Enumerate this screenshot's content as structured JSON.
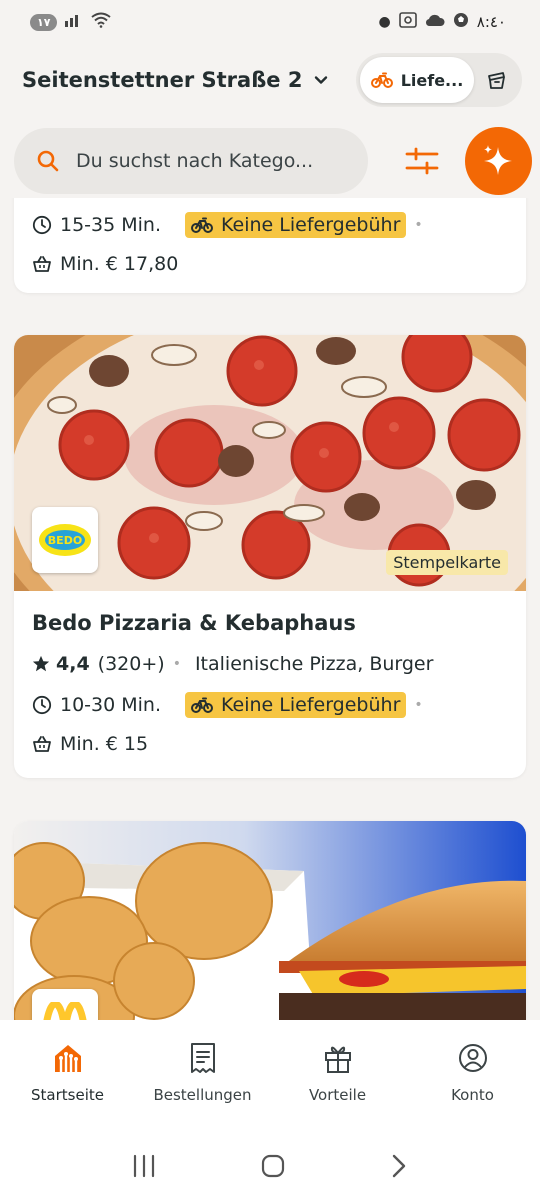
{
  "status_bar": {
    "left_badge": "١٧",
    "right_time": "٨:٤٠"
  },
  "header": {
    "address": "Seitenstettner Straße 2",
    "delivery_toggle_label": "Liefe...",
    "active_mode": "delivery"
  },
  "search": {
    "placeholder": "Du suchst nach Katego..."
  },
  "colors": {
    "accent": "#f36805",
    "badge_yellow": "#f6c543",
    "stempel_bg": "#f8e8a9"
  },
  "restaurants": [
    {
      "time": "15-35 Min.",
      "fee": "Keine Liefergebühr",
      "min_order": "Min. € 17,80"
    },
    {
      "name": "Bedo Pizzaria & Kebaphaus",
      "rating": "4,4",
      "rating_count": "(320+)",
      "cuisines": "Italienische Pizza, Burger",
      "time": "10-30 Min.",
      "fee": "Keine Liefergebühr",
      "min_order": "Min. € 15",
      "badge": "Stempelkarte",
      "logo_text": "BEDO"
    },
    {
      "logo_text": "M"
    }
  ],
  "bottom_nav": {
    "items": [
      {
        "label": "Startseite",
        "icon": "home-icon",
        "active": true
      },
      {
        "label": "Bestellungen",
        "icon": "receipt-icon",
        "active": false
      },
      {
        "label": "Vorteile",
        "icon": "gift-icon",
        "active": false
      },
      {
        "label": "Konto",
        "icon": "account-icon",
        "active": false
      }
    ]
  }
}
